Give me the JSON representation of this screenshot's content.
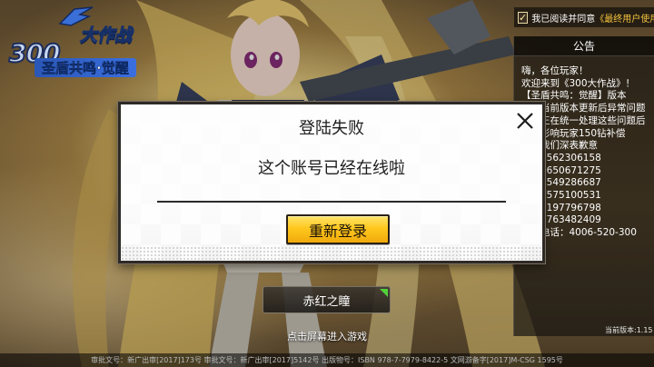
{
  "game": {
    "logo_main": "300",
    "logo_title": "大作战",
    "logo_subtitle": "圣盾共鸣·觉醒"
  },
  "agreement": {
    "checked": true,
    "check_glyph": "✓",
    "text": "我已阅读并同意",
    "link_text": "《最终用户使用"
  },
  "notice": {
    "header": "公告",
    "lines": [
      "嗨，各位玩家！",
      "欢迎来到《300大作战》！",
      "【圣盾共鸣：觉醒】版本",
      "已对当前版本更新后异常问题",
      "我们正在统一处理这些问题后",
      "给受影响玩家150钻补偿",
      "在此我们深表歉意",
      "群1：562306158",
      "群2：650671275",
      "群3：549286687",
      "群4：575100531",
      "群5：197796798",
      "群6：763482409",
      "客服电话：4006-520-300"
    ],
    "version": "当前版本:1.15"
  },
  "server": {
    "name": "赤红之瞳",
    "status_color": "#52d13b"
  },
  "tap_to_enter": "点击屏幕进入游戏",
  "footer": "审批文号：新广出审[2017]173号  审批文号：新广出审[2017]5142号  出版物号：ISBN 978-7-7979-8422-5  文网游备字[2017]M-CSG 1595号",
  "modal": {
    "title": "登陆失败",
    "message": "这个账号已经在线啦",
    "button_label": "重新登录",
    "close_icon": "close-icon"
  },
  "colors": {
    "accent_gold": "#ffc81f",
    "link_gold": "#f2c23e",
    "logo_blue": "#2a57b6"
  }
}
